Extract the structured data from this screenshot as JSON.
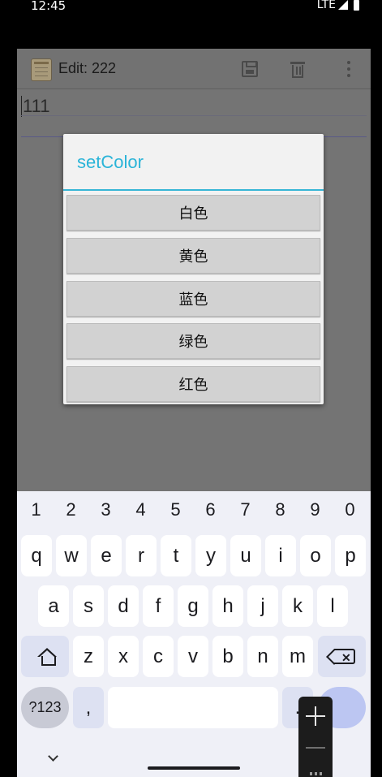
{
  "status_bar": {
    "time": "12:45",
    "network": "LTE"
  },
  "app_bar": {
    "title": "Edit: 222",
    "icons": [
      "notepad-icon",
      "save-icon",
      "delete-icon",
      "overflow-menu-icon"
    ]
  },
  "editor": {
    "text": "111"
  },
  "dialog": {
    "title": "setColor",
    "buttons": [
      {
        "label": "白色"
      },
      {
        "label": "黄色"
      },
      {
        "label": "蓝色"
      },
      {
        "label": "绿色"
      },
      {
        "label": "红色"
      }
    ]
  },
  "keyboard": {
    "numbers": [
      "1",
      "2",
      "3",
      "4",
      "5",
      "6",
      "7",
      "8",
      "9",
      "0"
    ],
    "row1": [
      "q",
      "w",
      "e",
      "r",
      "t",
      "y",
      "u",
      "i",
      "o",
      "p"
    ],
    "row2": [
      "a",
      "s",
      "d",
      "f",
      "g",
      "h",
      "j",
      "k",
      "l"
    ],
    "row3": [
      "z",
      "x",
      "c",
      "v",
      "b",
      "n",
      "m"
    ],
    "symbols_label": "?123",
    "comma": ",",
    "period": "."
  },
  "colors": {
    "accent": "#2ab4d8",
    "dialog_bg": "#f2f2f2",
    "button_bg": "#d2d2d2",
    "keyboard_bg": "#eff0f7"
  }
}
